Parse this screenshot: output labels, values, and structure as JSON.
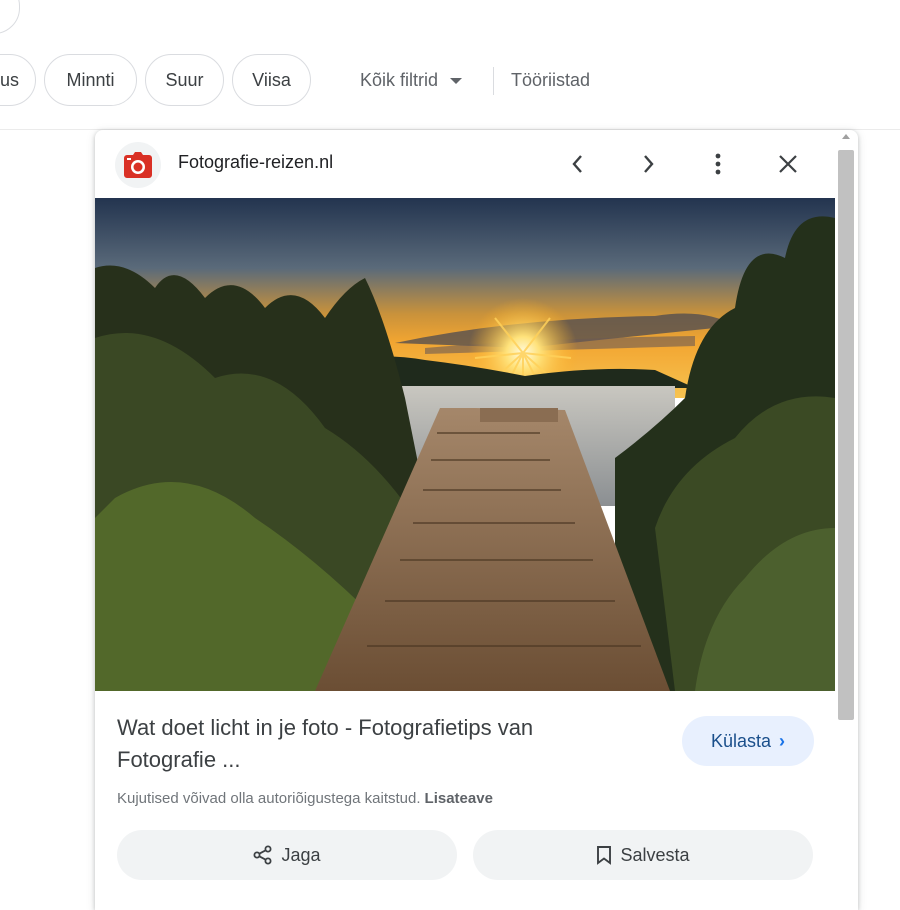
{
  "chips": [
    {
      "label": "us"
    },
    {
      "label": "Minnti"
    },
    {
      "label": "Suur"
    },
    {
      "label": "Viisa"
    }
  ],
  "filters": {
    "label": "Kõik filtrid",
    "tools_label": "Tööriistad"
  },
  "preview": {
    "site_name": "Fotografie-reizen.nl",
    "site_icon": "camera-icon",
    "title": "Wat doet licht in je foto - Fotografietips van Fotografie ...",
    "visit_label": "Külasta",
    "copyright_text": "Kujutised võivad olla autoriõigustega kaitstud.",
    "learn_more": "Lisateave",
    "share_label": "Jaga",
    "save_label": "Salvesta"
  },
  "colors": {
    "visit_bg": "#e8f0fe",
    "logo_red": "#d93025",
    "chip_border": "#dadce0"
  }
}
